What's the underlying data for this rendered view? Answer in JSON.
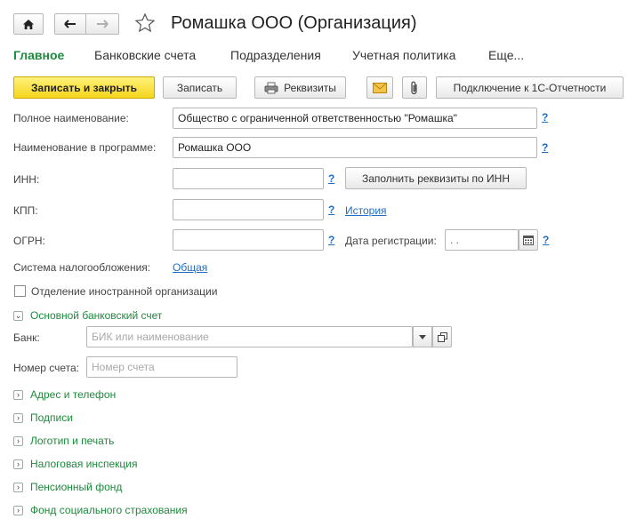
{
  "header": {
    "title": "Ромашка ООО (Организация)"
  },
  "tabs": [
    "Главное",
    "Банковские счета",
    "Подразделения",
    "Учетная политика",
    "Еще..."
  ],
  "toolbar": {
    "save_close": "Записать и закрыть",
    "save": "Записать",
    "requisites": "Реквизиты",
    "connect": "Подключение к 1С-Отчетности"
  },
  "form": {
    "full_name_label": "Полное наименование:",
    "full_name_value": "Общество с ограниченной ответственностью \"Ромашка\"",
    "program_name_label": "Наименование в программе:",
    "program_name_value": "Ромашка ООО",
    "inn_label": "ИНН:",
    "kpp_label": "КПП:",
    "ogrn_label": "ОГРН:",
    "fill_by_inn": "Заполнить реквизиты по ИНН",
    "history_link": "История",
    "reg_date_label": "Дата регистрации:",
    "reg_date_value": " .  .",
    "tax_system_label": "Система налогообложения:",
    "tax_system_value": "Общая",
    "foreign_branch_label": "Отделение иностранной организации",
    "help": "?"
  },
  "bank": {
    "section_title": "Основной банковский счет",
    "bank_label": "Банк:",
    "bank_placeholder": "БИК или наименование",
    "account_label": "Номер счета:",
    "account_placeholder": "Номер счета"
  },
  "sections": [
    "Адрес и телефон",
    "Подписи",
    "Логотип и печать",
    "Налоговая инспекция",
    "Пенсионный фонд",
    "Фонд социального страхования"
  ],
  "colors": {
    "accent_green": "#1e8a3c",
    "link_blue": "#1e6ec8",
    "primary_button": "#f5d51c"
  }
}
